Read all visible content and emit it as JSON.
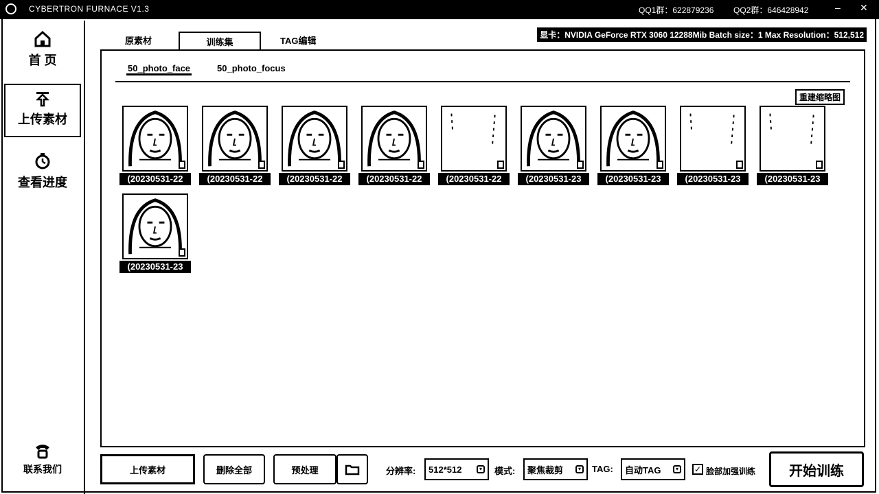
{
  "window": {
    "title": "CYBERTRON FURNACE V1.3",
    "qq1": "QQ1群：622879236",
    "qq2": "QQ2群：646428942",
    "minimize": "–",
    "close": "✕"
  },
  "sidebar": {
    "items": [
      {
        "label": "首 页",
        "icon": "home-icon"
      },
      {
        "label": "上传素材",
        "icon": "upload-icon"
      },
      {
        "label": "查看进度",
        "icon": "progress-icon"
      }
    ],
    "contact": {
      "label": "联系我们",
      "icon": "phone-icon"
    }
  },
  "tabs": [
    "原素材",
    "训练集",
    "TAG编辑"
  ],
  "gpu_info": "显卡：NVIDIA GeForce RTX 3060 12288Mib  Batch size：1  Max Resolution：512,512",
  "subtabs": [
    "50_photo_face",
    "50_photo_focus"
  ],
  "rebuild_label": "重建缩略图",
  "thumbnails": [
    {
      "name": "(20230531-22"
    },
    {
      "name": "(20230531-22"
    },
    {
      "name": "(20230531-22"
    },
    {
      "name": "(20230531-22"
    },
    {
      "name": "(20230531-22"
    },
    {
      "name": "(20230531-23"
    },
    {
      "name": "(20230531-23"
    },
    {
      "name": "(20230531-23"
    },
    {
      "name": "(20230531-23"
    },
    {
      "name": "(20230531-23"
    }
  ],
  "bottom": {
    "upload": "上传素材",
    "delete_all": "删除全部",
    "preprocess": "预处理",
    "resolution_label": "分辨率:",
    "resolution_value": "512*512",
    "mode_label": "模式:",
    "mode_value": "聚焦裁剪",
    "tag_label": "TAG:",
    "tag_value": "自动TAG",
    "face_enhance": "脸部加强训练",
    "face_enhance_checked": true,
    "start": "开始训练"
  }
}
